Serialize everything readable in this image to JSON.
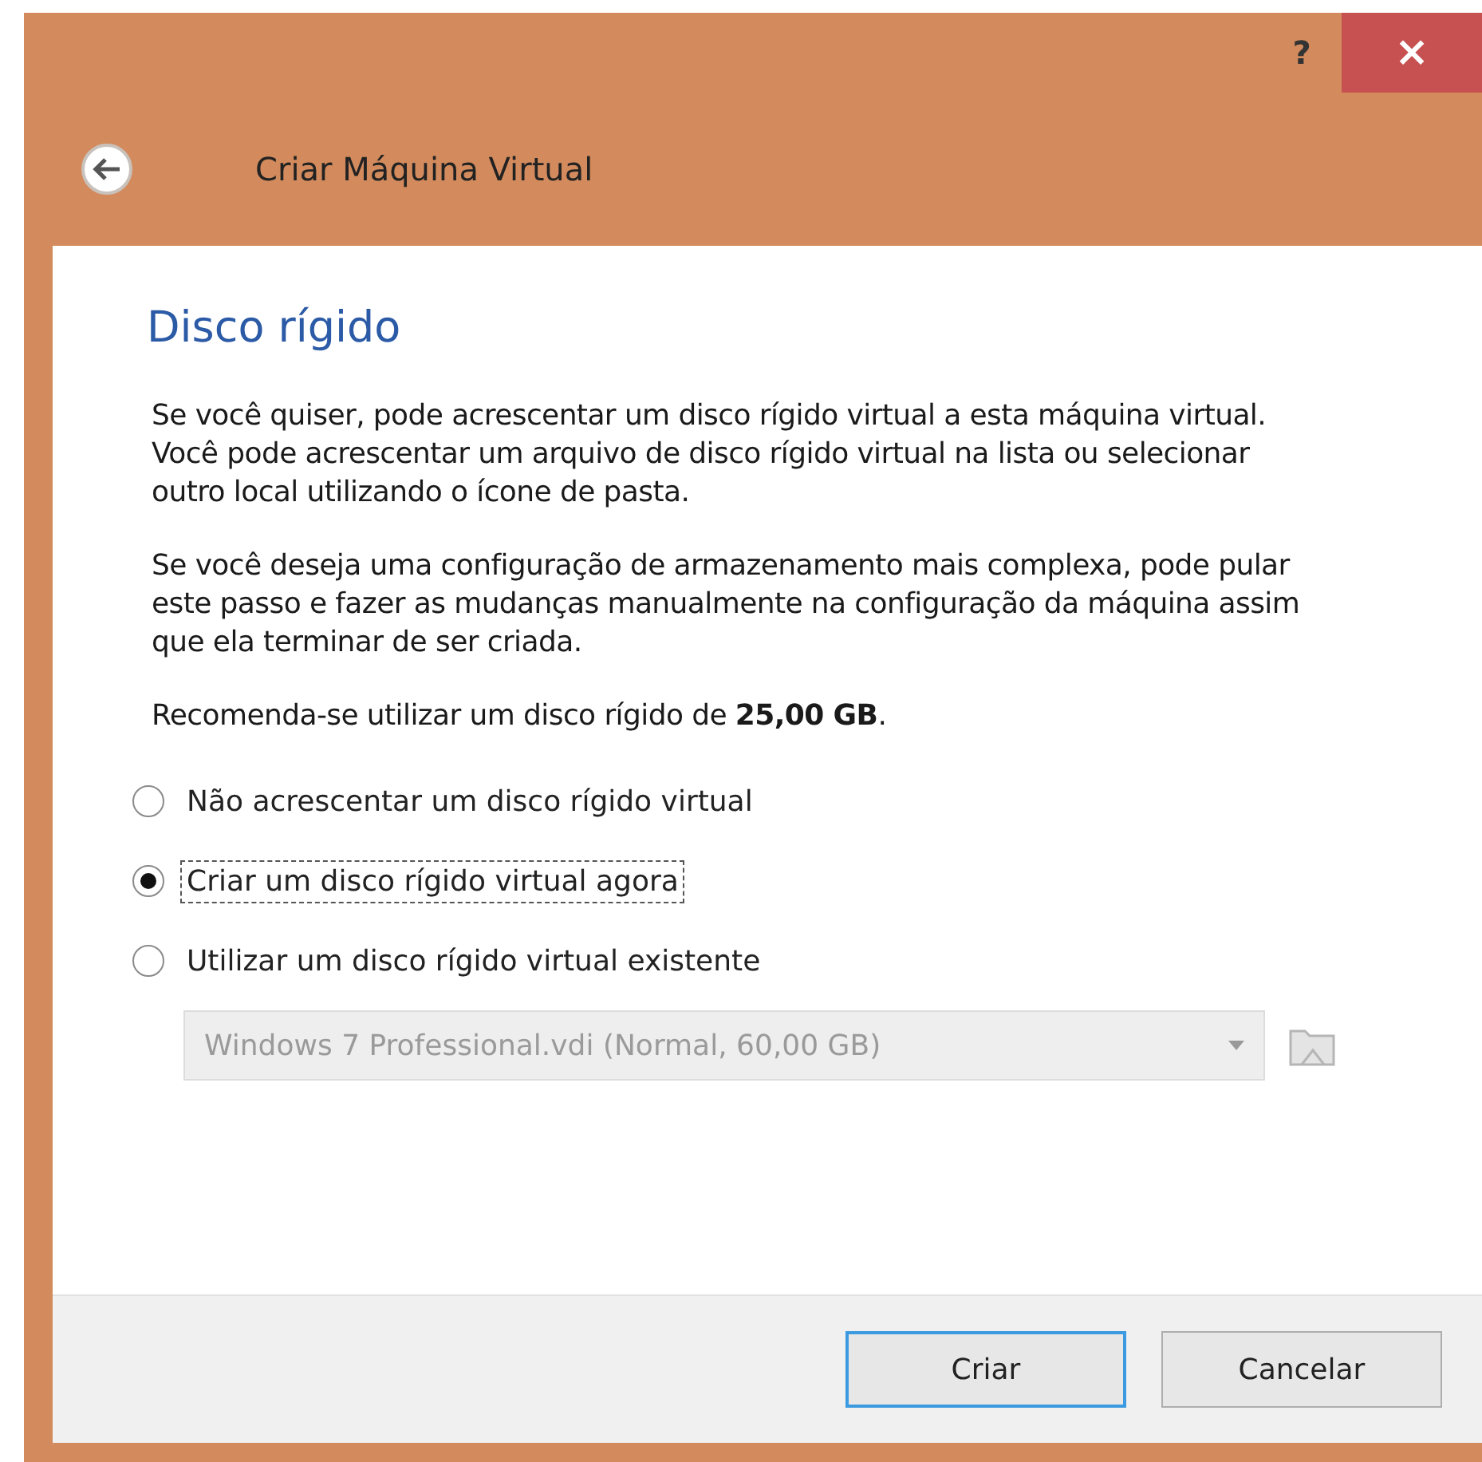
{
  "window": {
    "title": "Criar Máquina Virtual",
    "help": "?",
    "close": "×"
  },
  "page": {
    "heading": "Disco rígido",
    "paragraphs": [
      "Se você quiser, pode acrescentar um disco rígido virtual a esta máquina virtual. Você pode acrescentar um arquivo de disco rígido virtual na lista ou selecionar outro local utilizando o ícone de pasta.",
      "Se você deseja uma configuração de armazenamento mais complexa, pode pular este passo e fazer as mudanças manualmente na configuração da máquina assim que ela terminar de ser criada.",
      "Recomenda-se utilizar um disco rígido de **25,00 GB**."
    ],
    "options": [
      {
        "label": "Não acrescentar um disco rígido virtual",
        "selected": false
      },
      {
        "label": "Criar um disco rígido virtual agora",
        "selected": true
      },
      {
        "label": "Utilizar um disco rígido virtual existente",
        "selected": false
      }
    ],
    "disk_select": {
      "value": "Windows 7 Professional.vdi (Normal, 60,00 GB)",
      "disabled": true
    }
  },
  "buttons": [
    {
      "label": "Criar",
      "default": true
    },
    {
      "label": "Cancelar",
      "default": false
    }
  ]
}
